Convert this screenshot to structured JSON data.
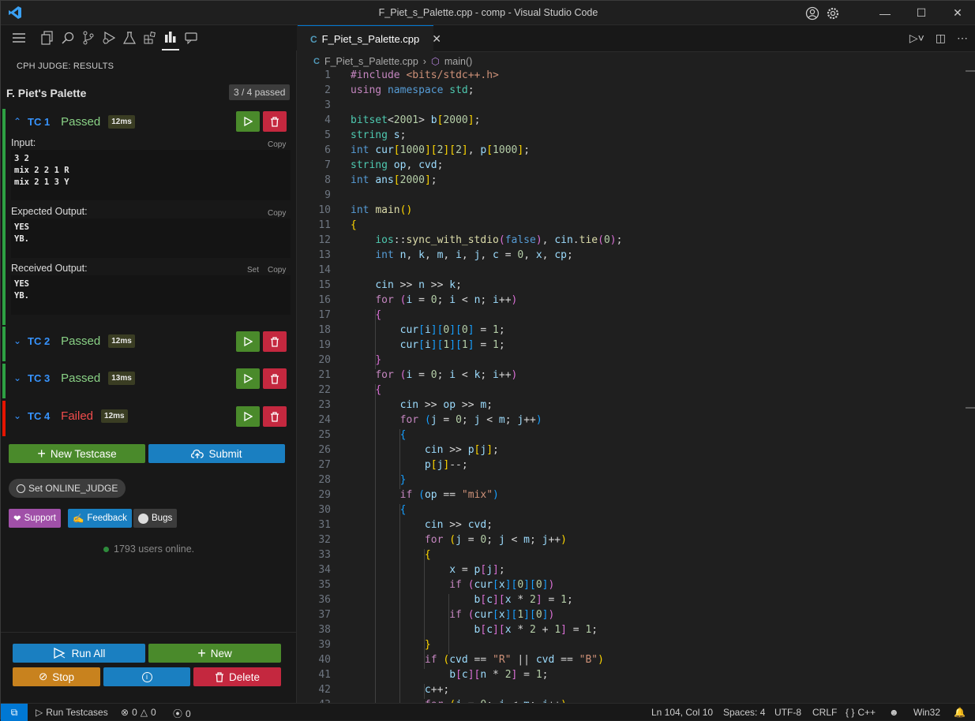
{
  "window": {
    "title": "F_Piet_s_Palette.cpp - comp - Visual Studio Code"
  },
  "sidebar": {
    "header": "CPH JUDGE: RESULTS",
    "problem_title": "F. Piet's Palette",
    "passed_summary": "3 / 4 passed",
    "testcases": [
      {
        "name": "TC 1",
        "status": "Passed",
        "time": "12ms",
        "expanded": true,
        "input_label": "Input:",
        "input": "3 2\nmix 2 2 1 R\nmix 2 1 3 Y",
        "expected_label": "Expected Output:",
        "expected": "YES\nYB.",
        "received_label": "Received Output:",
        "received": "YES\nYB.",
        "copy": "Copy",
        "set": "Set"
      },
      {
        "name": "TC 2",
        "status": "Passed",
        "time": "12ms"
      },
      {
        "name": "TC 3",
        "status": "Passed",
        "time": "13ms"
      },
      {
        "name": "TC 4",
        "status": "Failed",
        "time": "12ms"
      }
    ],
    "new_testcase": "New Testcase",
    "submit": "Submit",
    "online_judge": "Set ONLINE_JUDGE",
    "support": "Support",
    "feedback": "Feedback",
    "bugs": "Bugs",
    "online_users": "1793 users online.",
    "run_all": "Run All",
    "new": "New",
    "stop": "Stop",
    "delete": "Delete",
    "colors": {
      "passed": "#89d185",
      "failed": "#f14c4c",
      "green_bar": "#2ea043",
      "red_bar": "#e51400"
    }
  },
  "editor": {
    "tab_label": "F_Piet_s_Palette.cpp",
    "breadcrumb_file": "F_Piet_s_Palette.cpp",
    "breadcrumb_symbol": "main()"
  },
  "statusbar": {
    "run_testcases": "Run Testcases",
    "errors": "0",
    "warnings": "0",
    "ports": "0",
    "position": "Ln 104, Col 10",
    "spaces": "Spaces: 4",
    "encoding": "UTF-8",
    "eol": "CRLF",
    "language": "C++",
    "platform": "Win32"
  }
}
